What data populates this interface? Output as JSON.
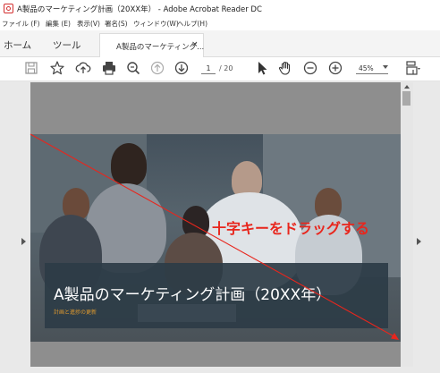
{
  "window": {
    "title": "A製品のマーケティング計画（20XX年） - Adobe Acrobat Reader DC"
  },
  "menu": [
    "ファイル (F)",
    "編集 (E)",
    "表示(V)",
    "署名(S)",
    "ウィンドウ(W)",
    "ヘルプ(H)"
  ],
  "tabs": {
    "home": "ホーム",
    "tools": "ツール",
    "document": "A製品のマーケティング...",
    "close": "×"
  },
  "toolbar": {
    "page_current": "1",
    "page_total": "/ 20",
    "zoom": "45%"
  },
  "slide": {
    "title": "A製品のマーケティング計画（20XX年）",
    "subtitle": "計画と進捗の更新"
  },
  "annotation": {
    "text": "十字キーをドラッグする",
    "color": "#e8261d"
  },
  "icons": [
    "app-logo-icon",
    "save-icon",
    "bookmark-star-icon",
    "upload-cloud-icon",
    "print-icon",
    "zoom-search-icon",
    "page-up-icon",
    "page-down-icon",
    "select-arrow-icon",
    "hand-icon",
    "zoom-out-icon",
    "zoom-in-icon",
    "page-fit-icon"
  ],
  "colors": {
    "accent": "#d32f2f",
    "slide_subtitle": "#e09a2e",
    "document_background": "#8e8e8e"
  }
}
